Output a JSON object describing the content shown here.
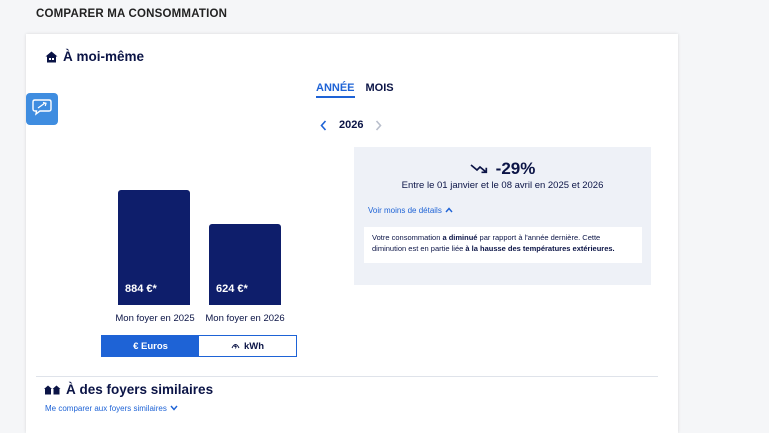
{
  "page": {
    "heading": "COMPARER MA CONSOMMATION"
  },
  "self_section": {
    "title": "À moi-même"
  },
  "tabs": [
    {
      "label": "ANNÉE",
      "active": true
    },
    {
      "label": "MOIS",
      "active": false
    }
  ],
  "year_nav": {
    "year": "2026"
  },
  "chart_data": {
    "type": "bar",
    "categories": [
      "Mon foyer en 2025",
      "Mon foyer en 2026"
    ],
    "values": [
      884,
      624
    ],
    "value_labels": [
      "884 €*",
      "624 €*"
    ],
    "unit": "€",
    "color": "#0e1e6b"
  },
  "unit_toggle": {
    "euros_label": "€ Euros",
    "kwh_label": "kWh",
    "active": "euros"
  },
  "summary": {
    "delta": "-29%",
    "period": "Entre le 01 janvier et le 08 avril en 2025 et 2026",
    "details_link": "Voir moins de détails",
    "explanation": {
      "part1": "Votre consommation ",
      "bold1": "a diminué",
      "part2": " par rapport à l'année dernière. Cette diminution est en partie liée ",
      "bold2": "à la hausse des températures extérieures."
    }
  },
  "similar_section": {
    "title": "À des foyers similaires",
    "compare_link": "Me comparer aux foyers similaires"
  },
  "colors": {
    "accent": "#1e63d6",
    "navy": "#0e1e6b",
    "panel_bg": "#eef1f7",
    "feedback_button": "#3f8de0"
  }
}
